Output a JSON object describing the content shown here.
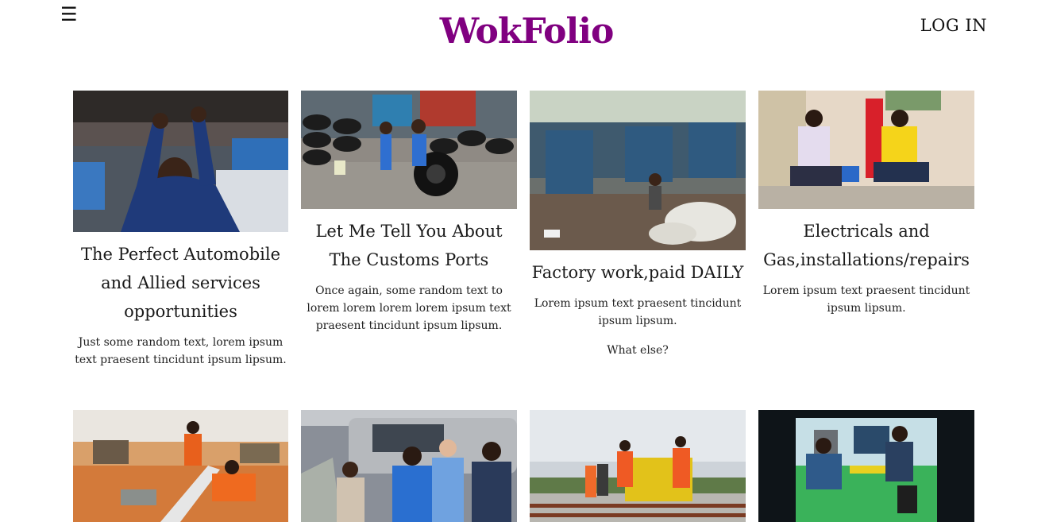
{
  "header": {
    "menu_glyph": "☰",
    "brand": "WokFolio",
    "login_label": "LOG IN"
  },
  "colors": {
    "brand": "#800080"
  },
  "cards": [
    {
      "title": "The Perfect Automobile and Allied services opportunities",
      "text": "Just some random text, lorem ipsum text praesent tincidunt ipsum lipsum."
    },
    {
      "title": "Let Me Tell You About The Customs Ports",
      "text": "Once again, some random text to lorem lorem lorem lorem ipsum text praesent tincidunt ipsum lipsum."
    },
    {
      "title": "Factory work,paid DAILY",
      "text": "Lorem ipsum text praesent tincidunt ipsum lipsum.",
      "text2": "What else?"
    },
    {
      "title": "Electricals and Gas,installations/repairs",
      "text": "Lorem ipsum text praesent tincidunt ipsum lipsum."
    }
  ]
}
